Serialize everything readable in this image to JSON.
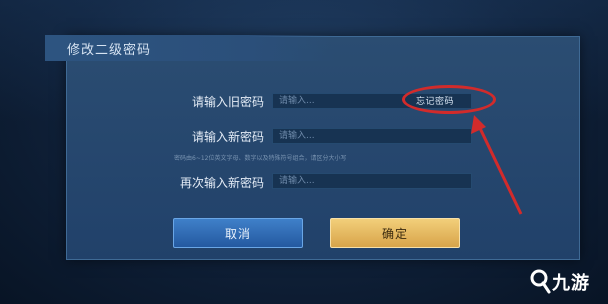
{
  "dialog": {
    "title": "修改二级密码"
  },
  "form": {
    "old_password_label": "请输入旧密码",
    "old_password_placeholder": "请输入...",
    "forgot_password_label": "忘记密码",
    "new_password_label": "请输入新密码",
    "new_password_placeholder": "请输入...",
    "hint": "密码由6~12位英文字母、数字以及特殊符号组合，请区分大小写",
    "confirm_password_label": "再次输入新密码",
    "confirm_password_placeholder": "请输入..."
  },
  "buttons": {
    "cancel_label": "取消",
    "ok_label": "确定"
  },
  "watermark": {
    "text": "九游"
  },
  "colors": {
    "annotation": "#d22b2b",
    "cancel_button": "#2f6db5",
    "ok_button": "#e6b961"
  }
}
